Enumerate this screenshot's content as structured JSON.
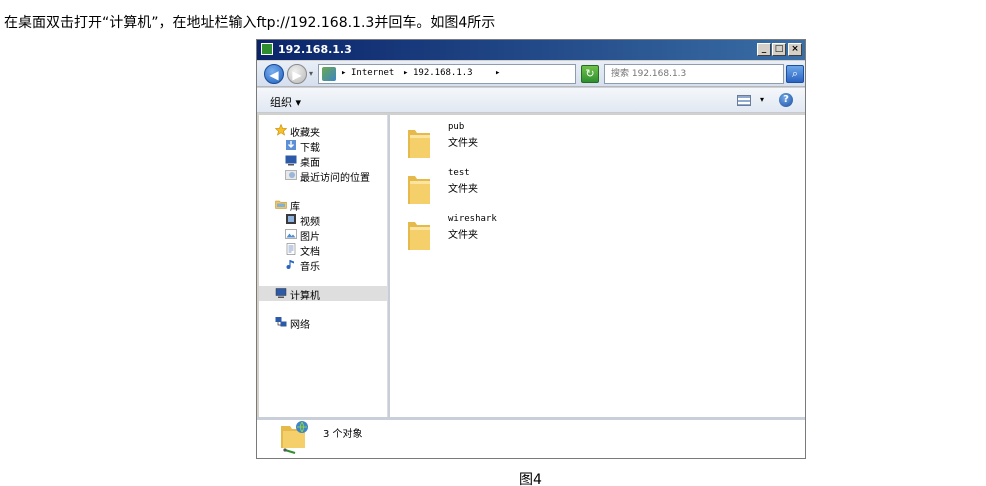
{
  "intro_text": "在桌面双击打开“计算机”，在地址栏输入ftp://192.168.1.3并回车。如图4所示",
  "caption": "图4",
  "window": {
    "title": "192.168.1.3",
    "controls": {
      "minimize": "_",
      "maximize": "□",
      "close": "×"
    }
  },
  "address": {
    "crumbs": [
      "Internet",
      "192.168.1.3"
    ],
    "separator": "▸",
    "dropdown": "▾",
    "search_placeholder": "搜索 192.168.1.3"
  },
  "toolbar": {
    "organize_label": "组织 ▾",
    "help_label": "?"
  },
  "nav": {
    "favorites": {
      "label": "收藏夹",
      "items": [
        "下载",
        "桌面",
        "最近访问的位置"
      ]
    },
    "libraries": {
      "label": "库",
      "items": [
        "视频",
        "图片",
        "文档",
        "音乐"
      ]
    },
    "computer": {
      "label": "计算机"
    },
    "network": {
      "label": "网络"
    }
  },
  "folders": [
    {
      "name": "pub",
      "type": "文件夹"
    },
    {
      "name": "test",
      "type": "文件夹"
    },
    {
      "name": "wireshark",
      "type": "文件夹"
    }
  ],
  "details": {
    "count_text": "3 个对象"
  },
  "colors": {
    "titlebar": "#0a246a",
    "folder": "#f4cf6a",
    "selection": "#dedede"
  }
}
